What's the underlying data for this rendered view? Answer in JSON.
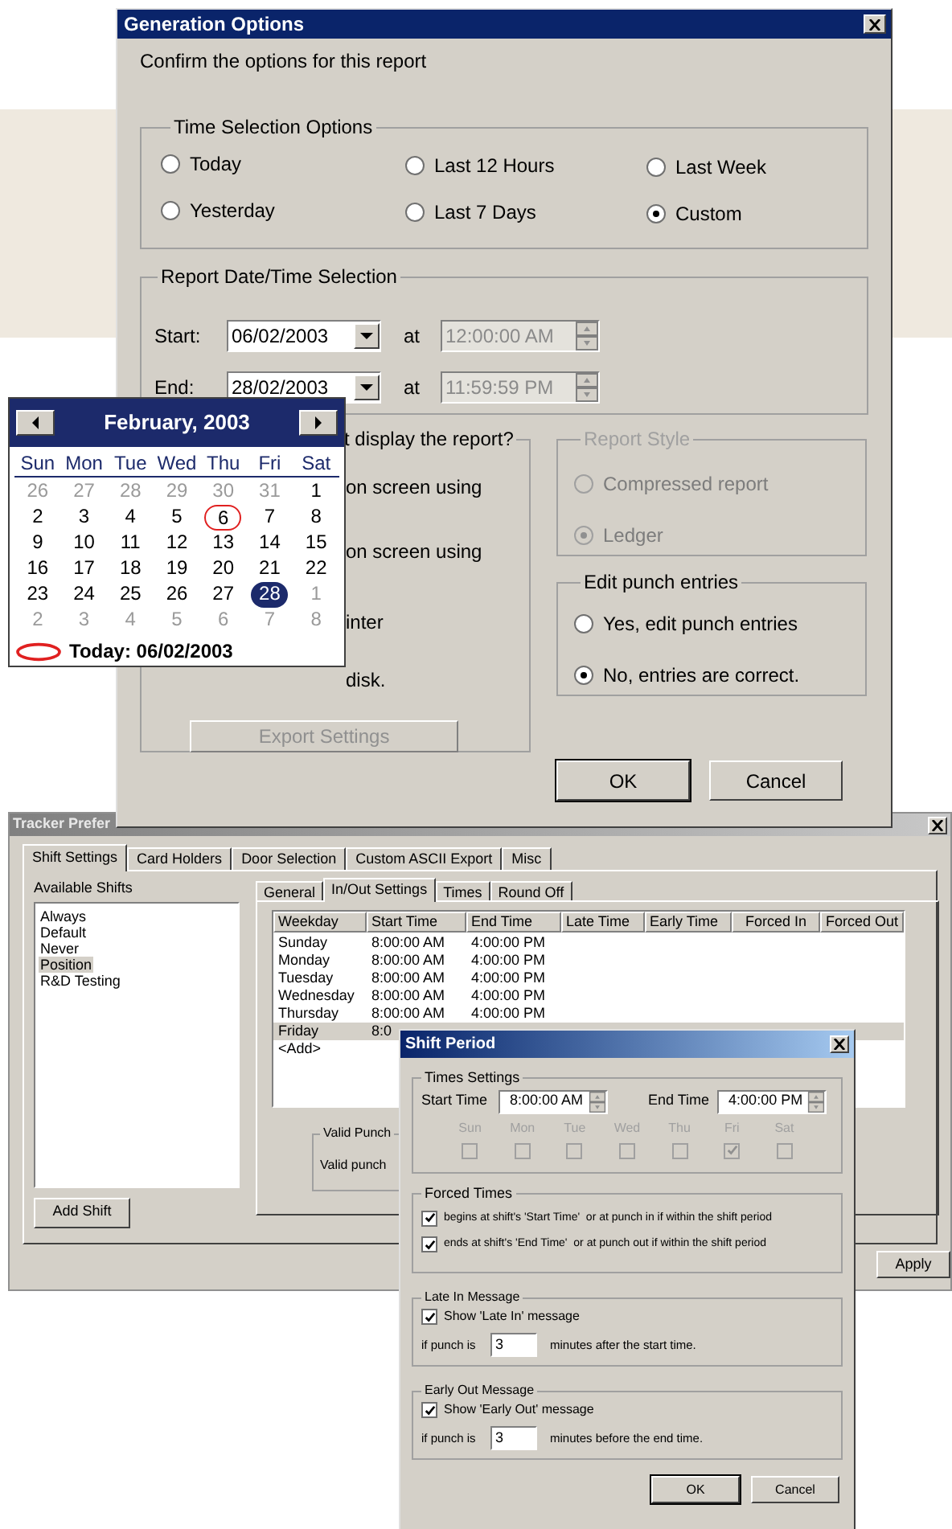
{
  "generation_options": {
    "title": "Generation Options",
    "prompt": "Confirm the options for this report",
    "time_selection": {
      "title": "Time Selection Options",
      "options": [
        {
          "label": "Today",
          "selected": false
        },
        {
          "label": "Yesterday",
          "selected": false
        },
        {
          "label": "Last 12 Hours",
          "selected": false
        },
        {
          "label": "Last 7 Days",
          "selected": false
        },
        {
          "label": "Last Week",
          "selected": false
        },
        {
          "label": "Custom",
          "selected": true
        }
      ]
    },
    "date_time": {
      "title": "Report Date/Time Selection",
      "rows": [
        {
          "label": "Start:",
          "date": "06/02/2003",
          "at": "at",
          "time": "12:00:00 AM"
        },
        {
          "label": "End:",
          "date": "28/02/2003",
          "at": "at",
          "time": "11:59:59 PM"
        }
      ]
    },
    "output": {
      "title": "t display the report?",
      "options": [
        "on screen using",
        "on screen using",
        "inter",
        "disk."
      ],
      "export_button": "Export Settings"
    },
    "report_style": {
      "title": "Report Style",
      "disabled": true,
      "options": [
        {
          "label": "Compressed report",
          "selected": false
        },
        {
          "label": "Ledger",
          "selected": true
        }
      ]
    },
    "edit_punch": {
      "title": "Edit punch entries",
      "options": [
        {
          "label": "Yes, edit punch entries",
          "selected": false
        },
        {
          "label": "No, entries are correct.",
          "selected": true
        }
      ]
    },
    "buttons": [
      {
        "label": "OK",
        "default": true
      },
      {
        "label": "Cancel",
        "default": false
      }
    ]
  },
  "calendar": {
    "month": "February, 2003",
    "weekdays": [
      "Sun",
      "Mon",
      "Tue",
      "Wed",
      "Thu",
      "Fri",
      "Sat"
    ],
    "days": [
      {
        "label": "26",
        "other_month": true,
        "selected": false,
        "circled": false
      },
      {
        "label": "27",
        "other_month": true,
        "selected": false,
        "circled": false
      },
      {
        "label": "28",
        "other_month": true,
        "selected": false,
        "circled": false
      },
      {
        "label": "29",
        "other_month": true,
        "selected": false,
        "circled": false
      },
      {
        "label": "30",
        "other_month": true,
        "selected": false,
        "circled": false
      },
      {
        "label": "31",
        "other_month": true,
        "selected": false,
        "circled": false
      },
      {
        "label": "1",
        "other_month": false,
        "selected": false,
        "circled": false
      },
      {
        "label": "2",
        "other_month": false,
        "selected": false,
        "circled": false
      },
      {
        "label": "3",
        "other_month": false,
        "selected": false,
        "circled": false
      },
      {
        "label": "4",
        "other_month": false,
        "selected": false,
        "circled": false
      },
      {
        "label": "5",
        "other_month": false,
        "selected": false,
        "circled": false
      },
      {
        "label": "6",
        "other_month": false,
        "selected": false,
        "circled": true
      },
      {
        "label": "7",
        "other_month": false,
        "selected": false,
        "circled": false
      },
      {
        "label": "8",
        "other_month": false,
        "selected": false,
        "circled": false
      },
      {
        "label": "9",
        "other_month": false,
        "selected": false,
        "circled": false
      },
      {
        "label": "10",
        "other_month": false,
        "selected": false,
        "circled": false
      },
      {
        "label": "11",
        "other_month": false,
        "selected": false,
        "circled": false
      },
      {
        "label": "12",
        "other_month": false,
        "selected": false,
        "circled": false
      },
      {
        "label": "13",
        "other_month": false,
        "selected": false,
        "circled": false
      },
      {
        "label": "14",
        "other_month": false,
        "selected": false,
        "circled": false
      },
      {
        "label": "15",
        "other_month": false,
        "selected": false,
        "circled": false
      },
      {
        "label": "16",
        "other_month": false,
        "selected": false,
        "circled": false
      },
      {
        "label": "17",
        "other_month": false,
        "selected": false,
        "circled": false
      },
      {
        "label": "18",
        "other_month": false,
        "selected": false,
        "circled": false
      },
      {
        "label": "19",
        "other_month": false,
        "selected": false,
        "circled": false
      },
      {
        "label": "20",
        "other_month": false,
        "selected": false,
        "circled": false
      },
      {
        "label": "21",
        "other_month": false,
        "selected": false,
        "circled": false
      },
      {
        "label": "22",
        "other_month": false,
        "selected": false,
        "circled": false
      },
      {
        "label": "23",
        "other_month": false,
        "selected": false,
        "circled": false
      },
      {
        "label": "24",
        "other_month": false,
        "selected": false,
        "circled": false
      },
      {
        "label": "25",
        "other_month": false,
        "selected": false,
        "circled": false
      },
      {
        "label": "26",
        "other_month": false,
        "selected": false,
        "circled": false
      },
      {
        "label": "27",
        "other_month": false,
        "selected": false,
        "circled": false
      },
      {
        "label": "28",
        "other_month": false,
        "selected": true,
        "circled": false
      },
      {
        "label": "1",
        "other_month": true,
        "selected": false,
        "circled": false
      },
      {
        "label": "2",
        "other_month": true,
        "selected": false,
        "circled": false
      },
      {
        "label": "3",
        "other_month": true,
        "selected": false,
        "circled": false
      },
      {
        "label": "4",
        "other_month": true,
        "selected": false,
        "circled": false
      },
      {
        "label": "5",
        "other_month": true,
        "selected": false,
        "circled": false
      },
      {
        "label": "6",
        "other_month": true,
        "selected": false,
        "circled": false
      },
      {
        "label": "7",
        "other_month": true,
        "selected": false,
        "circled": false
      },
      {
        "label": "8",
        "other_month": true,
        "selected": false,
        "circled": false
      }
    ],
    "today": "Today: 06/02/2003"
  },
  "tracker_preferences": {
    "title": "Tracker Prefer",
    "tabs": [
      {
        "label": "Shift Settings",
        "selected": true
      },
      {
        "label": "Card Holders",
        "selected": false
      },
      {
        "label": "Door Selection",
        "selected": false
      },
      {
        "label": "Custom ASCII Export",
        "selected": false
      },
      {
        "label": "Misc",
        "selected": false
      }
    ],
    "shifts_label": "Available Shifts",
    "shifts": [
      {
        "label": "Always",
        "selected": false
      },
      {
        "label": "Default",
        "selected": false
      },
      {
        "label": "Never",
        "selected": false
      },
      {
        "label": "Position",
        "selected": true
      },
      {
        "label": "R&D Testing",
        "selected": false
      }
    ],
    "add_shift": "Add Shift",
    "subtabs": [
      {
        "label": "General",
        "selected": false
      },
      {
        "label": "In/Out Settings",
        "selected": true
      },
      {
        "label": "Times",
        "selected": false
      },
      {
        "label": "Round Off",
        "selected": false
      }
    ],
    "table": {
      "columns": [
        "Weekday",
        "Start Time",
        "End Time",
        "Late Time",
        "Early Time",
        "Forced In",
        "Forced Out"
      ],
      "rows": [
        {
          "cells": [
            "Sunday",
            "8:00:00 AM",
            "4:00:00 PM"
          ],
          "selected": false
        },
        {
          "cells": [
            "Monday",
            "8:00:00 AM",
            "4:00:00 PM"
          ],
          "selected": false
        },
        {
          "cells": [
            "Tuesday",
            "8:00:00 AM",
            "4:00:00 PM"
          ],
          "selected": false
        },
        {
          "cells": [
            "Wednesday",
            "8:00:00 AM",
            "4:00:00 PM"
          ],
          "selected": false
        },
        {
          "cells": [
            "Thursday",
            "8:00:00 AM",
            "4:00:00 PM"
          ],
          "selected": false
        },
        {
          "cells": [
            "Friday",
            "8:0"
          ],
          "selected": true
        },
        {
          "cells": [
            "<Add>"
          ],
          "selected": false
        }
      ]
    },
    "valid_punch": {
      "title": "Valid Punch",
      "text": "Valid punch"
    },
    "apply": "Apply"
  },
  "shift_period": {
    "title": "Shift Period",
    "times": {
      "title": "Times Settings",
      "start_label": "Start Time",
      "start": "8:00:00 AM",
      "end_label": "End Time",
      "end": "4:00:00 PM",
      "days_disabled": true,
      "days": [
        {
          "label": "Sun",
          "checked": false
        },
        {
          "label": "Mon",
          "checked": false
        },
        {
          "label": "Tue",
          "checked": false
        },
        {
          "label": "Wed",
          "checked": false
        },
        {
          "label": "Thu",
          "checked": false
        },
        {
          "label": "Fri",
          "checked": true
        },
        {
          "label": "Sat",
          "checked": false
        }
      ]
    },
    "forced": {
      "title": "Forced Times",
      "options": [
        {
          "label": "begins at shift's 'Start Time'  or at punch in if within the shift period",
          "checked": true
        },
        {
          "label": "ends at shift's 'End Time'  or at punch out if within the shift period",
          "checked": true
        }
      ]
    },
    "messages": [
      {
        "title": "Late In Message",
        "check_label": "Show 'Late In' message",
        "checked": true,
        "prefix": "if punch is",
        "value": "3",
        "suffix": "minutes after the start time."
      },
      {
        "title": "Early Out Message",
        "check_label": "Show 'Early Out' message",
        "checked": true,
        "prefix": "if punch is",
        "value": "3",
        "suffix": "minutes before the end time."
      }
    ],
    "buttons": [
      "OK",
      "Cancel"
    ]
  }
}
